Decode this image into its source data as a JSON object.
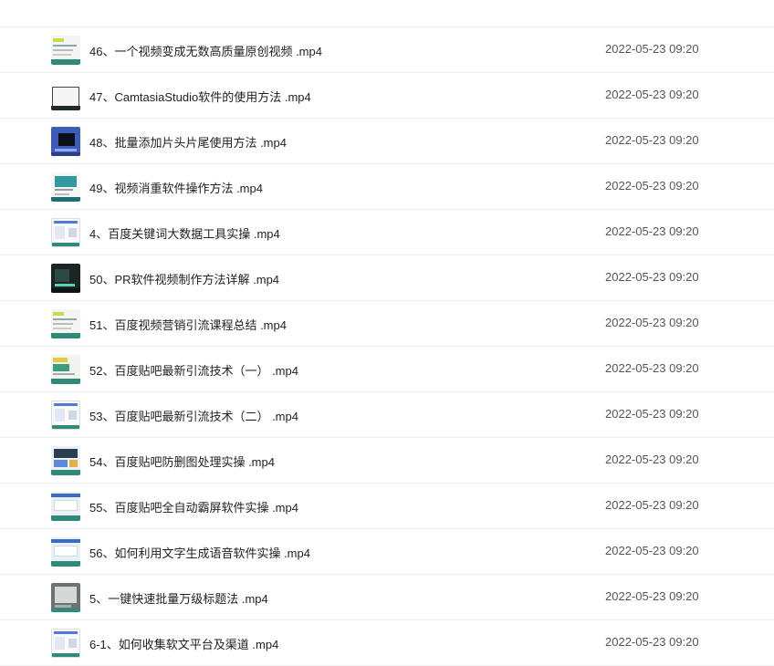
{
  "files": [
    {
      "thumb": "t-doc",
      "name": "46、一个视频变成无数高质量原创视频 .mp4",
      "date": "2022-05-23 09:20"
    },
    {
      "thumb": "t-dark",
      "name": "47、CamtasiaStudio软件的使用方法 .mp4",
      "date": "2022-05-23 09:20"
    },
    {
      "thumb": "t-blue",
      "name": "48、批量添加片头片尾使用方法 .mp4",
      "date": "2022-05-23 09:20"
    },
    {
      "thumb": "t-teal",
      "name": "49、视频消重软件操作方法 .mp4",
      "date": "2022-05-23 09:20"
    },
    {
      "thumb": "t-page",
      "name": "4、百度关键词大数据工具实操 .mp4",
      "date": "2022-05-23 09:20"
    },
    {
      "thumb": "t-black",
      "name": "50、PR软件视频制作方法详解 .mp4",
      "date": "2022-05-23 09:20"
    },
    {
      "thumb": "t-doc",
      "name": "51、百度视频营销引流课程总结 .mp4",
      "date": "2022-05-23 09:20"
    },
    {
      "thumb": "t-green",
      "name": "52、百度贴吧最新引流技术（一） .mp4",
      "date": "2022-05-23 09:20"
    },
    {
      "thumb": "t-page",
      "name": "53、百度贴吧最新引流技术（二） .mp4",
      "date": "2022-05-23 09:20"
    },
    {
      "thumb": "t-mix",
      "name": "54、百度贴吧防删图处理实操 .mp4",
      "date": "2022-05-23 09:20"
    },
    {
      "thumb": "t-screen",
      "name": "55、百度贴吧全自动霸屏软件实操 .mp4",
      "date": "2022-05-23 09:20"
    },
    {
      "thumb": "t-screen",
      "name": "56、如何利用文字生成语音软件实操 .mp4",
      "date": "2022-05-23 09:20"
    },
    {
      "thumb": "t-gray",
      "name": "5、一键快速批量万级标题法 .mp4",
      "date": "2022-05-23 09:20"
    },
    {
      "thumb": "t-page",
      "name": "6-1、如何收集软文平台及渠道 .mp4",
      "date": "2022-05-23 09:20"
    }
  ]
}
